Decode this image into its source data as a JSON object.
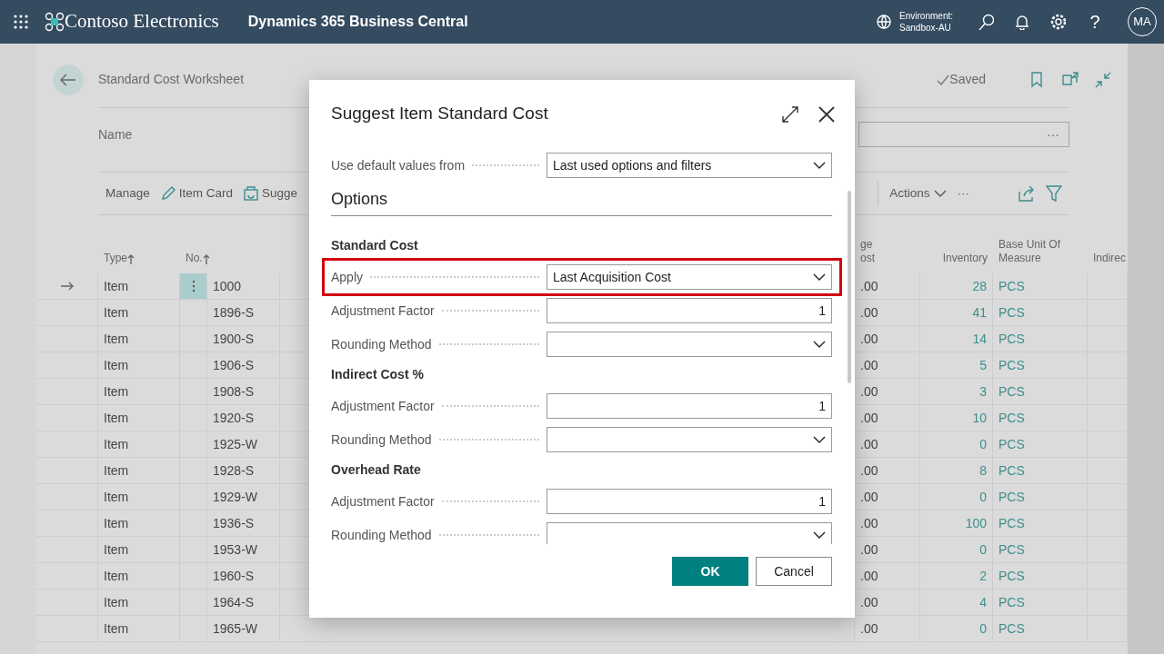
{
  "app_bar": {
    "brand": "Contoso Electronics",
    "product": "Dynamics 365 Business Central",
    "environment_label": "Environment:",
    "environment": "Sandbox-AU",
    "help": "?",
    "avatar": "MA"
  },
  "page": {
    "title": "Standard Cost Worksheet",
    "status": "Saved",
    "name_label": "Name",
    "name_more": "···",
    "actions": [
      {
        "label": "Manage",
        "kind": "text"
      },
      {
        "label": "Item Card",
        "kind": "pencil"
      },
      {
        "label": "Sugge",
        "kind": "suggest"
      }
    ],
    "actions_right": {
      "label": "Actions",
      "more": "···"
    }
  },
  "table": {
    "left_columns": [
      {
        "label": "Type",
        "sorted": true
      },
      {
        "label": "No.",
        "sorted": true
      }
    ],
    "right_columns": [
      {
        "label": "ge ost",
        "sorted": false
      },
      {
        "label": "Inventory",
        "sorted": false
      },
      {
        "label": "Base Unit Of Measure",
        "sorted": false
      },
      {
        "label": "Indirec",
        "sorted": false
      }
    ],
    "rows": [
      {
        "type": "Item",
        "no": "1000",
        "cost": ".00",
        "inventory": "28",
        "unit": "PCS",
        "selected": true
      },
      {
        "type": "Item",
        "no": "1896-S",
        "cost": ".00",
        "inventory": "41",
        "unit": "PCS",
        "selected": false
      },
      {
        "type": "Item",
        "no": "1900-S",
        "cost": ".00",
        "inventory": "14",
        "unit": "PCS",
        "selected": false
      },
      {
        "type": "Item",
        "no": "1906-S",
        "cost": ".00",
        "inventory": "5",
        "unit": "PCS",
        "selected": false
      },
      {
        "type": "Item",
        "no": "1908-S",
        "cost": ".00",
        "inventory": "3",
        "unit": "PCS",
        "selected": false
      },
      {
        "type": "Item",
        "no": "1920-S",
        "cost": ".00",
        "inventory": "10",
        "unit": "PCS",
        "selected": false
      },
      {
        "type": "Item",
        "no": "1925-W",
        "cost": ".00",
        "inventory": "0",
        "unit": "PCS",
        "selected": false
      },
      {
        "type": "Item",
        "no": "1928-S",
        "cost": ".00",
        "inventory": "8",
        "unit": "PCS",
        "selected": false
      },
      {
        "type": "Item",
        "no": "1929-W",
        "cost": ".00",
        "inventory": "0",
        "unit": "PCS",
        "selected": false
      },
      {
        "type": "Item",
        "no": "1936-S",
        "cost": ".00",
        "inventory": "100",
        "unit": "PCS",
        "selected": false
      },
      {
        "type": "Item",
        "no": "1953-W",
        "cost": ".00",
        "inventory": "0",
        "unit": "PCS",
        "selected": false
      },
      {
        "type": "Item",
        "no": "1960-S",
        "cost": ".00",
        "inventory": "2",
        "unit": "PCS",
        "selected": false
      },
      {
        "type": "Item",
        "no": "1964-S",
        "cost": ".00",
        "inventory": "4",
        "unit": "PCS",
        "selected": false
      },
      {
        "type": "Item",
        "no": "1965-W",
        "cost": ".00",
        "inventory": "0",
        "unit": "PCS",
        "selected": false
      }
    ]
  },
  "dialog": {
    "title": "Suggest Item Standard Cost",
    "items": [
      {
        "kind": "dropdown",
        "label": "Use default values from",
        "value": "Last used options and filters",
        "highlighted": false
      },
      {
        "kind": "section",
        "label": "Options"
      },
      {
        "kind": "group",
        "label": "Standard Cost"
      },
      {
        "kind": "dropdown",
        "label": "Apply",
        "value": "Last Acquisition Cost",
        "highlighted": true
      },
      {
        "kind": "number",
        "label": "Adjustment Factor",
        "value": "1",
        "highlighted": false
      },
      {
        "kind": "dropdown",
        "label": "Rounding Method",
        "highlighted": false
      },
      {
        "kind": "group",
        "label": "Indirect Cost %"
      },
      {
        "kind": "number",
        "label": "Adjustment Factor",
        "value": "1",
        "highlighted": false
      },
      {
        "kind": "dropdown",
        "label": "Rounding Method",
        "highlighted": false
      },
      {
        "kind": "group",
        "label": "Overhead Rate"
      },
      {
        "kind": "number",
        "label": "Adjustment Factor",
        "value": "1",
        "highlighted": false
      },
      {
        "kind": "dropdown",
        "label": "Rounding Method",
        "highlighted": false
      }
    ],
    "buttons": [
      {
        "label": "OK",
        "kind": "primary"
      },
      {
        "label": "Cancel",
        "kind": "secondary"
      }
    ]
  }
}
